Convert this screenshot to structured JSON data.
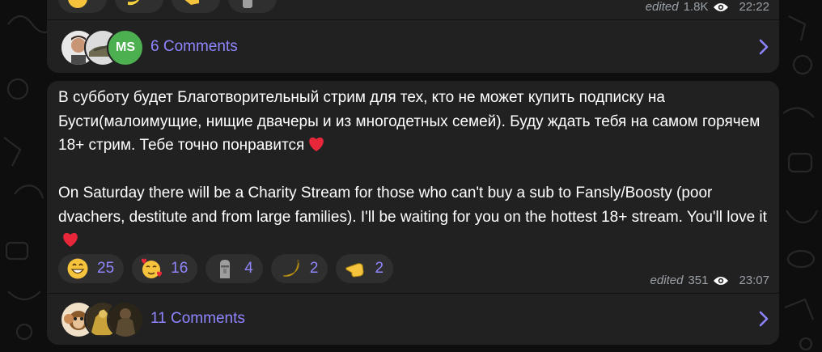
{
  "post1": {
    "meta": {
      "edited": "edited",
      "views": "1.8K",
      "time": "22:22"
    },
    "reactions": [
      {
        "icon": "heart-eyes-emoji",
        "count": ""
      },
      {
        "icon": "banana-emoji",
        "count": ""
      },
      {
        "icon": "pointing-hand-emoji",
        "count": ""
      },
      {
        "icon": "moai-emoji",
        "count": ""
      }
    ],
    "comments": {
      "label": "6 Comments",
      "avatar_initials": "MS"
    }
  },
  "post2": {
    "text_ru": "В субботу будет Благотворительный стрим для тех, кто не может купить подписку на Бусти(малоимущие, нищие двачеры и из многодетных семей). Буду ждать тебя на самом горячем 18+ стрим. Тебе точно понравится",
    "text_en": "On Saturday there will be a Charity Stream for those who can't buy a sub to Fansly/Boosty (poor dvachers, destitute and from large families). I'll be waiting for you on the hottest 18+ stream. You'll love it",
    "reactions": [
      {
        "icon": "grinning-emoji",
        "count": "25"
      },
      {
        "icon": "smiling-hearts-emoji",
        "count": "16"
      },
      {
        "icon": "moai-emoji",
        "count": "4"
      },
      {
        "icon": "banana-emoji",
        "count": "2"
      },
      {
        "icon": "pointing-hand-emoji",
        "count": "2"
      }
    ],
    "meta": {
      "edited": "edited",
      "views": "351",
      "time": "23:07"
    },
    "comments": {
      "label": "11 Comments"
    }
  },
  "colors": {
    "accent": "#8f86ff",
    "bubble": "#212121",
    "background": "#0e0e0e",
    "meta": "#9aa0a6"
  }
}
